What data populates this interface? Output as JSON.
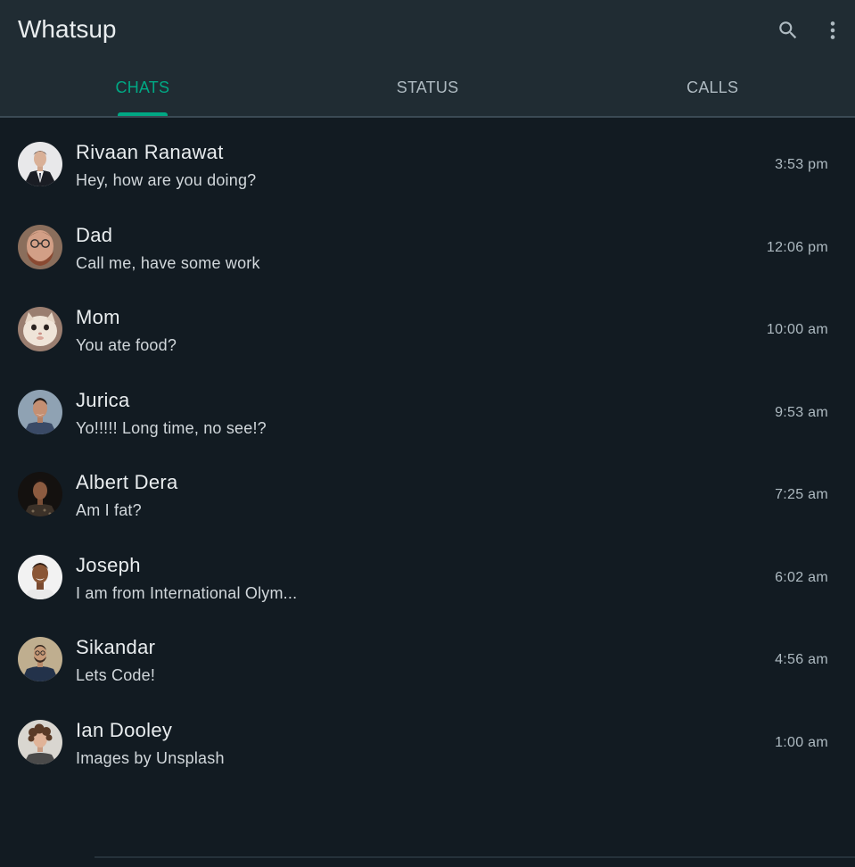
{
  "app": {
    "title": "Whatsup"
  },
  "colors": {
    "appbar": "#202c33",
    "background": "#121b22",
    "accent": "#00a884",
    "text_primary": "#e9edef",
    "text_secondary": "#aebac1"
  },
  "actions": [
    {
      "icon": "search-icon"
    },
    {
      "icon": "more-vert-icon"
    }
  ],
  "tabs": [
    {
      "label": "CHATS",
      "active": true
    },
    {
      "label": "STATUS",
      "active": false
    },
    {
      "label": "CALLS",
      "active": false
    }
  ],
  "chats": [
    {
      "name": "Rivaan Ranawat",
      "message": "Hey, how are you doing?",
      "time": "3:53 pm",
      "avatar": "man-in-suit"
    },
    {
      "name": "Dad",
      "message": "Call me, have some work",
      "time": "12:06 pm",
      "avatar": "bearded-man-glasses"
    },
    {
      "name": "Mom",
      "message": "You ate food?",
      "time": "10:00 am",
      "avatar": "cat"
    },
    {
      "name": "Jurica",
      "message": "Yo!!!!! Long time, no see!?",
      "time": "9:53 am",
      "avatar": "smiling-man"
    },
    {
      "name": "Albert Dera",
      "message": "Am I fat?",
      "time": "7:25 am",
      "avatar": "man-dark-background"
    },
    {
      "name": "Joseph",
      "message": "I am from International Olym...",
      "time": "6:02 am",
      "avatar": "smiling-man-white-background"
    },
    {
      "name": "Sikandar",
      "message": "Lets Code!",
      "time": "4:56 am",
      "avatar": "man-with-glasses-beard"
    },
    {
      "name": "Ian Dooley",
      "message": "Images by Unsplash",
      "time": "1:00 am",
      "avatar": "curly-hair-woman"
    }
  ]
}
